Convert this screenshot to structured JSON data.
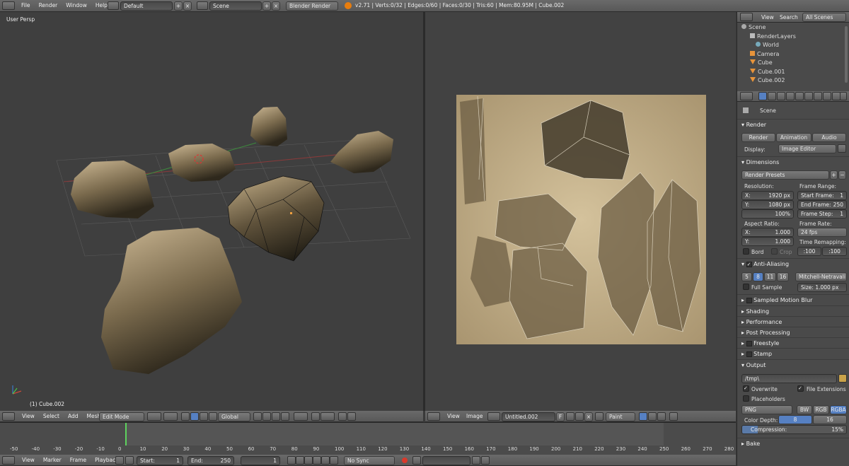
{
  "topbar": {
    "menus": [
      "File",
      "Render",
      "Window",
      "Help"
    ],
    "layout": "Default",
    "scene": "Scene",
    "engine": "Blender Render",
    "stats": "v2.71 | Verts:0/32 | Edges:0/60 | Faces:0/30 | Tris:60 | Mem:80.95M | Cube.002"
  },
  "viewport": {
    "label": "User Persp",
    "object": "(1) Cube.002",
    "header": {
      "menus": [
        "View",
        "Select",
        "Add",
        "Mesh"
      ],
      "mode": "Edit Mode",
      "orientation": "Global"
    }
  },
  "uv_editor": {
    "header": {
      "menus": [
        "View",
        "Image"
      ],
      "image": "Untitled.002",
      "image_flag": "F",
      "paint_mode": "Paint"
    }
  },
  "outliner": {
    "menus": [
      "View",
      "Search"
    ],
    "filter": "All Scenes",
    "items": [
      {
        "label": "Scene",
        "indent": 0
      },
      {
        "label": "RenderLayers",
        "indent": 1
      },
      {
        "label": "World",
        "indent": 1
      },
      {
        "label": "Camera",
        "indent": 1
      },
      {
        "label": "Cube",
        "indent": 1
      },
      {
        "label": "Cube.001",
        "indent": 1
      },
      {
        "label": "Cube.002",
        "indent": 1
      }
    ]
  },
  "properties": {
    "scene": "Scene",
    "render": {
      "title": "Render",
      "buttons": [
        "Render",
        "Animation",
        "Audio"
      ],
      "display_label": "Display:",
      "display_value": "Image Editor"
    },
    "dimensions": {
      "title": "Dimensions",
      "presets": "Render Presets",
      "resolution_label": "Resolution:",
      "res_x": "X:",
      "res_x_val": "1920 px",
      "res_y": "Y:",
      "res_y_val": "1080 px",
      "percent": "100%",
      "frame_range_label": "Frame Range:",
      "start_frame": "Start Frame:",
      "start_frame_val": "1",
      "end_frame": "End Frame:",
      "end_frame_val": "250",
      "frame_step": "Frame Step:",
      "frame_step_val": "1",
      "aspect_label": "Aspect Ratio:",
      "asp_x": "X:",
      "asp_x_val": "1.000",
      "asp_y": "Y:",
      "asp_y_val": "1.000",
      "frame_rate_label": "Frame Rate:",
      "frame_rate": "24 fps",
      "time_remap_label": "Time Remapping:",
      "remap_old": ":100",
      "remap_new": ":100",
      "bord": "Bord",
      "crop": "Crop"
    },
    "anti_aliasing": {
      "title": "Anti-Aliasing",
      "samples": [
        "5",
        "8",
        "11",
        "16"
      ],
      "filter": "Mitchell-Netravali",
      "full_sample": "Full Sample",
      "size": "Size:",
      "size_val": "1.000 px"
    },
    "collapsed": [
      "Sampled Motion Blur",
      "Shading",
      "Performance",
      "Post Processing",
      "Freestyle",
      "Stamp"
    ],
    "output": {
      "title": "Output",
      "path": "/tmp\\",
      "overwrite": "Overwrite",
      "file_extensions": "File Extensions",
      "placeholders": "Placeholders",
      "format": "PNG",
      "color_modes": [
        "BW",
        "RGB",
        "RGBA"
      ],
      "color_depth_label": "Color Depth:",
      "depth_8": "8",
      "depth_16": "16",
      "compression": "Compression:",
      "compression_val": "15%"
    },
    "bake": "Bake"
  },
  "timeline": {
    "ticks": [
      "-50",
      "-40",
      "-30",
      "-20",
      "-10",
      "0",
      "10",
      "20",
      "30",
      "40",
      "50",
      "60",
      "70",
      "80",
      "90",
      "100",
      "110",
      "120",
      "130",
      "140",
      "150",
      "160",
      "170",
      "180",
      "190",
      "200",
      "210",
      "220",
      "230",
      "240",
      "250",
      "260",
      "270",
      "280"
    ],
    "menus": [
      "View",
      "Marker",
      "Frame",
      "Playback"
    ],
    "start": "Start:",
    "start_val": "1",
    "end": "End:",
    "end_val": "250",
    "current": "1",
    "sync": "No Sync"
  },
  "colors": {
    "accent": "#5680c2",
    "rock_light": "#c9b48f",
    "rock_dark": "#3d3526",
    "uv_bg": "#c2ad84"
  }
}
